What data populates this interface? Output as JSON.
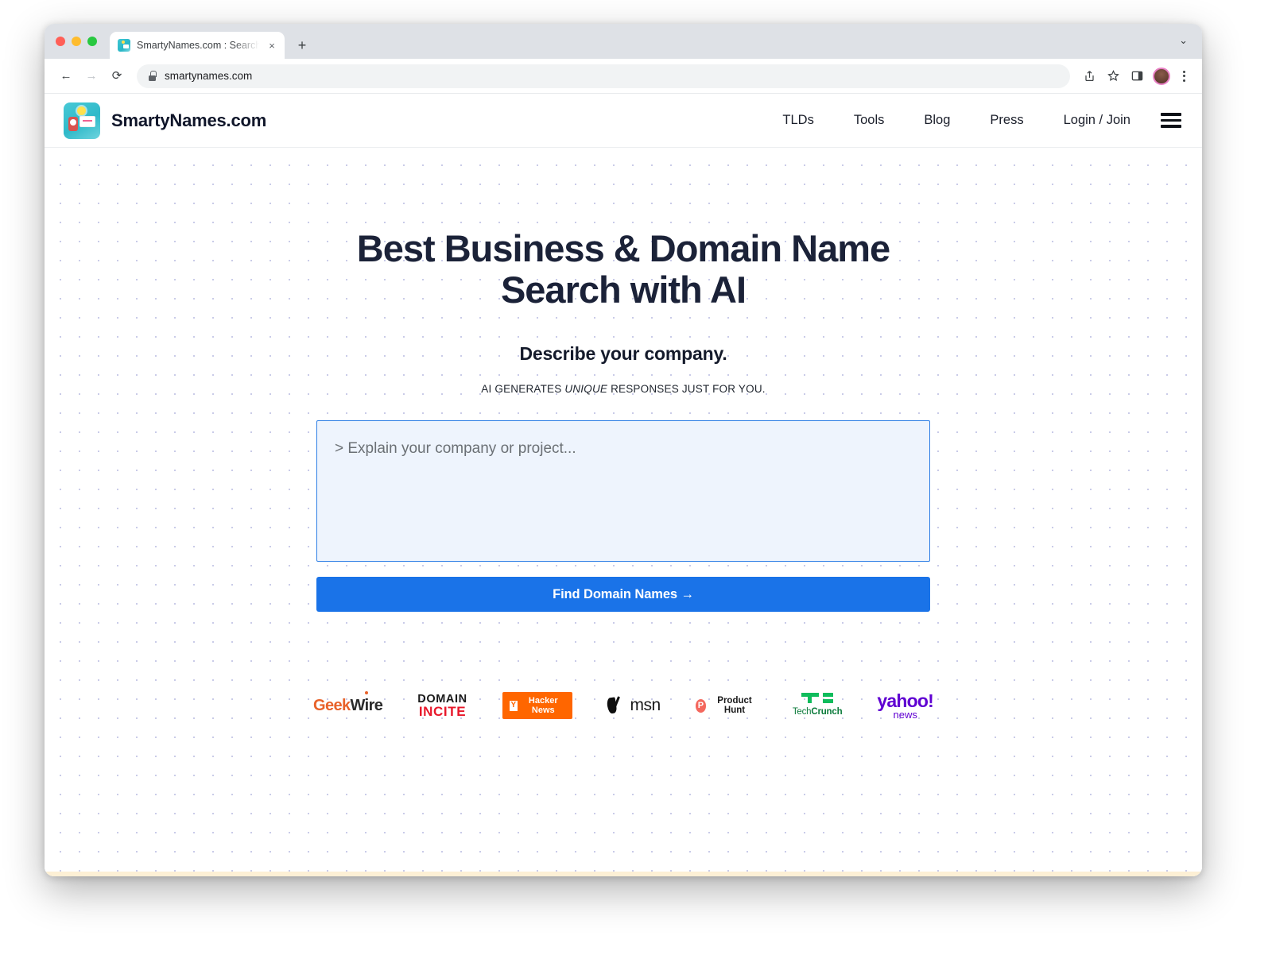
{
  "browser": {
    "tab": {
      "title": "SmartyNames.com : Search Do",
      "favicon_name": "smartynames-favicon",
      "close_label": "×"
    },
    "new_tab_label": "+",
    "tabstrip_chevron": "⌄",
    "toolbar": {
      "back_label": "←",
      "forward_label": "→",
      "reload_label": "⟳",
      "url": "smartynames.com",
      "share_label": "⇧",
      "bookmark_label": "☆",
      "sidepanel_label": "◫"
    }
  },
  "site_header": {
    "brand_name": "SmartyNames.com",
    "nav": [
      {
        "label": "TLDs"
      },
      {
        "label": "Tools"
      },
      {
        "label": "Blog"
      },
      {
        "label": "Press"
      },
      {
        "label": "Login / Join"
      }
    ]
  },
  "hero": {
    "headline_line1": "Best Business & Domain Name",
    "headline_line2_prefix": "Search ",
    "headline_line2_highlight": "with AI",
    "subhead": "Describe your company.",
    "tagline_before": "AI GENERATES ",
    "tagline_italic": "UNIQUE",
    "tagline_after": " RESPONSES JUST FOR YOU.",
    "input_placeholder": "> Explain your company or project...",
    "input_value": "",
    "cta_label": "Find Domain Names →"
  },
  "press_logos": [
    {
      "name": "geekwire",
      "part1": "Geek",
      "part2": "Wire"
    },
    {
      "name": "domain-incite",
      "part1": "DOMAIN",
      "part2": "INCITE"
    },
    {
      "name": "hacker-news",
      "badge": "Y",
      "label": "Hacker News"
    },
    {
      "name": "msn",
      "label": "msn"
    },
    {
      "name": "product-hunt",
      "badge": "P",
      "label": "Product Hunt"
    },
    {
      "name": "techcrunch",
      "part1": "Tech",
      "part2": "Crunch"
    },
    {
      "name": "yahoo-news",
      "part1": "yahoo!",
      "part2": "news"
    }
  ],
  "colors": {
    "accent_blue": "#1a73e8",
    "highlight_green": "#4dbd72",
    "headline_navy": "#1b2238",
    "input_bg": "#eef4fd",
    "input_border": "#2f7fe5",
    "bottom_strip": "#fdf0d5"
  }
}
